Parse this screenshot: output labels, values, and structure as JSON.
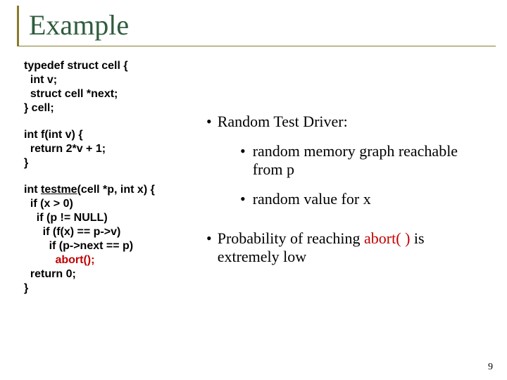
{
  "title": "Example",
  "code": {
    "b1_l1": "typedef struct cell {",
    "b1_l2": "  int v;",
    "b1_l3": "  struct cell *next;",
    "b1_l4": "} cell;",
    "b2_l1": "int f(int v) {",
    "b2_l2": "  return 2*v + 1;",
    "b2_l3": "}",
    "b3_l1a": "int ",
    "b3_l1b": "testme",
    "b3_l1c": "(cell *p, int x) {",
    "b3_l2": "  if (x > 0)",
    "b3_l3": "    if (p != NULL)",
    "b3_l4": "      if (f(x) == p->v)",
    "b3_l5": "        if (p->next == p)",
    "b3_l6a": "          ",
    "b3_l6b": "abort();",
    "b3_l7": "  return 0;",
    "b3_l8": "}"
  },
  "right": {
    "b1": "Random Test Driver:",
    "sub1": "random memory graph reachable from p",
    "sub2": "random value for x",
    "prob_a": "Probability of reaching ",
    "prob_b": "abort( )",
    "prob_c": " is extremely low"
  },
  "pagenum": "9"
}
